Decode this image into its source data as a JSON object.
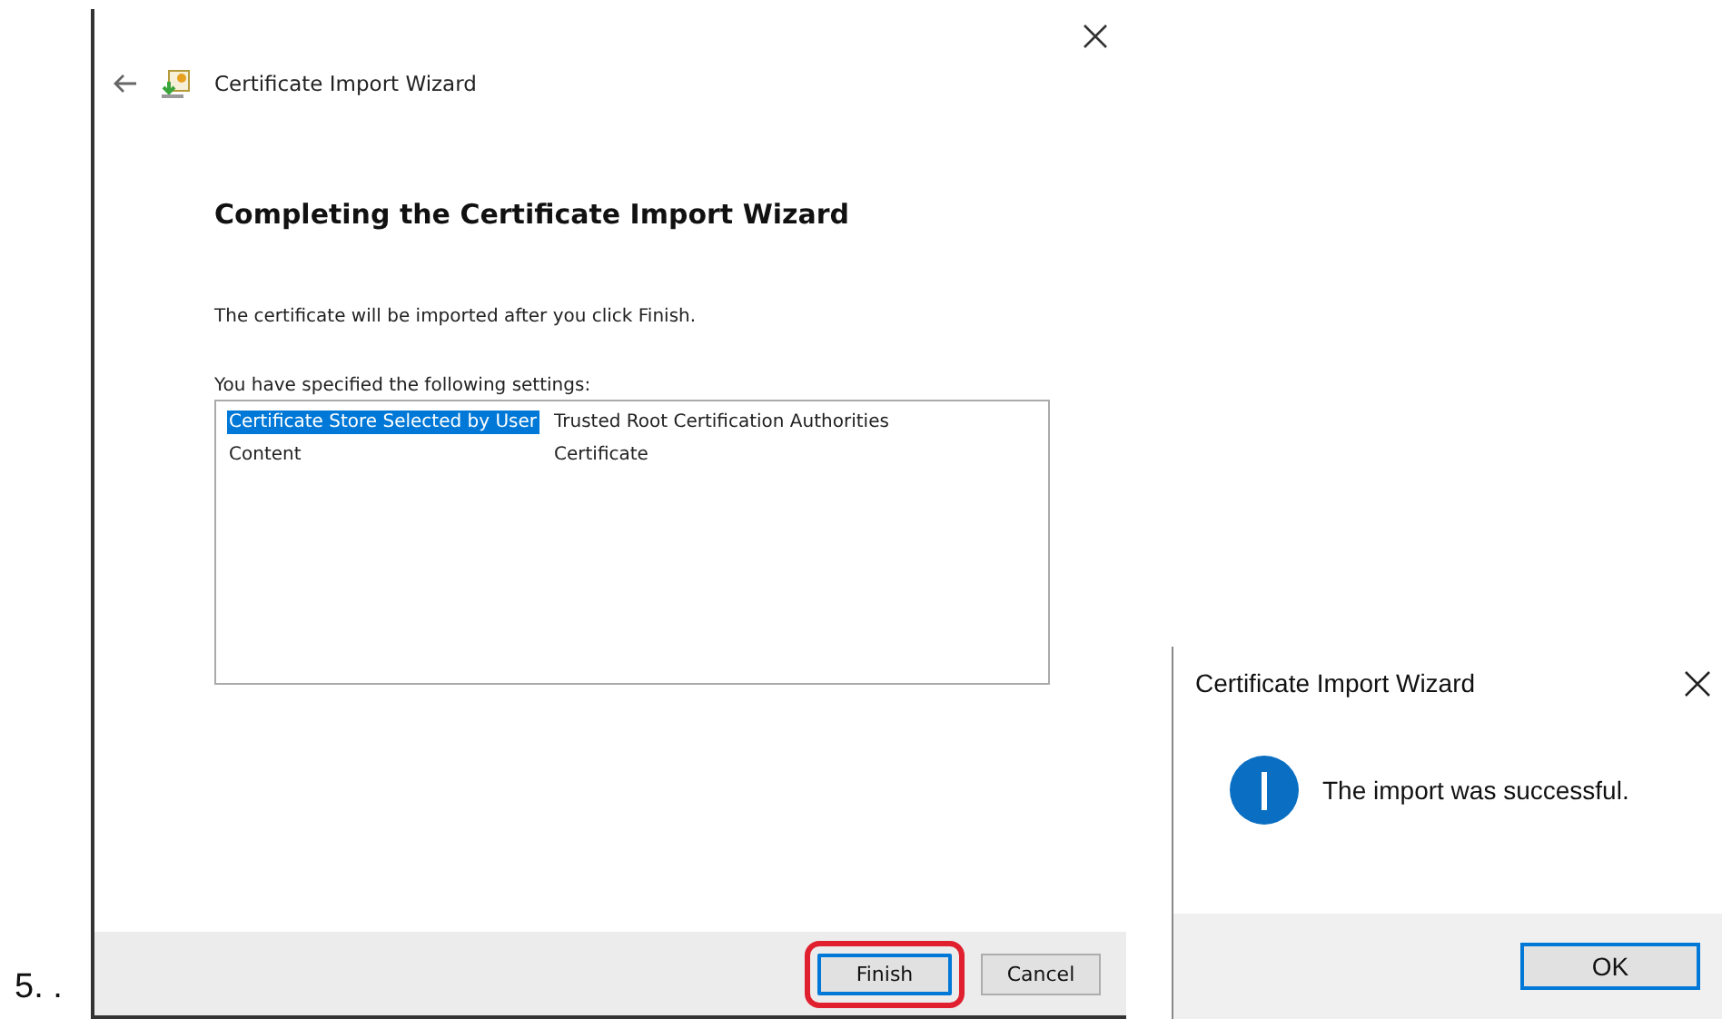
{
  "step_label": "5. .",
  "wizard": {
    "title": "Certificate Import Wizard",
    "heading": "Completing the Certificate Import Wizard",
    "message": "The certificate will be imported after you click Finish.",
    "settings_label": "You have specified the following settings:",
    "settings": [
      {
        "name": "Certificate Store Selected by User",
        "value": "Trusted Root Certification Authorities",
        "selected": true
      },
      {
        "name": "Content",
        "value": "Certificate",
        "selected": false
      }
    ],
    "buttons": [
      {
        "label": "Finish",
        "default": true,
        "highlighted": true
      },
      {
        "label": "Cancel",
        "default": false,
        "highlighted": false
      }
    ]
  },
  "dialog": {
    "title": "Certificate Import Wizard",
    "message": "The import was successful.",
    "buttons": [
      {
        "label": "OK",
        "default": true
      }
    ]
  }
}
